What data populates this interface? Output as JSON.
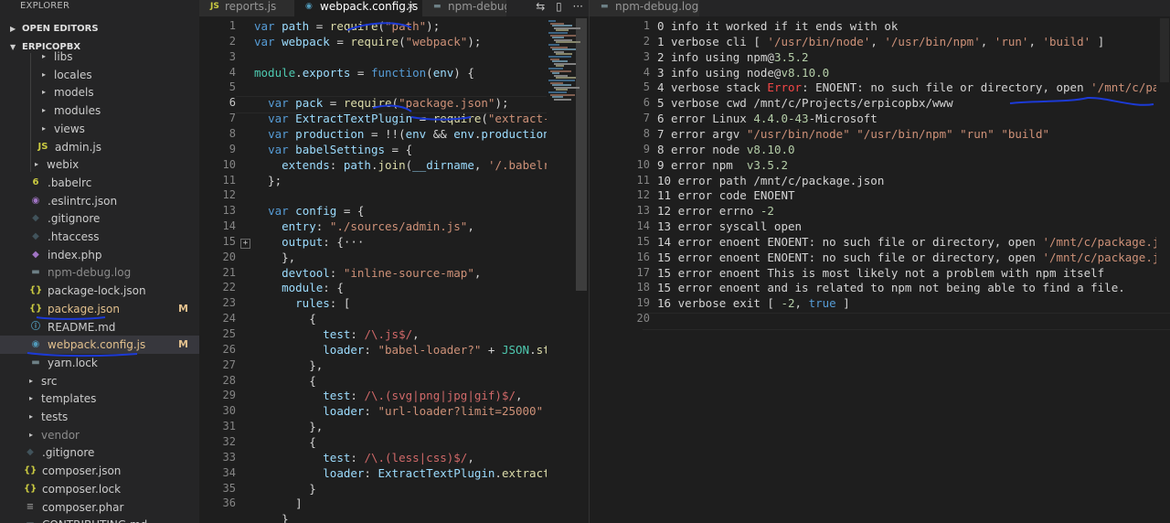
{
  "explorer": {
    "title": "EXPLORER",
    "open_editors": "OPEN EDITORS",
    "project": "ERPICOPBX",
    "items": [
      {
        "label": "libs",
        "chev": "▸"
      },
      {
        "label": "locales",
        "chev": "▸"
      },
      {
        "label": "models",
        "chev": "▸"
      },
      {
        "label": "modules",
        "chev": "▸"
      },
      {
        "label": "views",
        "chev": "▸"
      },
      {
        "label": "admin.js",
        "icon": "JS"
      },
      {
        "label": "webix",
        "chev": "▸"
      },
      {
        "label": ".babelrc",
        "icon": "6"
      },
      {
        "label": ".eslintrc.json",
        "icon": "◉"
      },
      {
        "label": ".gitignore",
        "icon": "◆"
      },
      {
        "label": ".htaccess",
        "icon": "◆"
      },
      {
        "label": "index.php",
        "icon": "◆"
      },
      {
        "label": "npm-debug.log",
        "icon": "▬"
      },
      {
        "label": "package-lock.json",
        "icon": "{}"
      },
      {
        "label": "package.json",
        "icon": "{}",
        "badge": "M"
      },
      {
        "label": "README.md",
        "icon": "ⓘ"
      },
      {
        "label": "webpack.config.js",
        "icon": "◉",
        "badge": "M"
      },
      {
        "label": "yarn.lock",
        "icon": "▬"
      },
      {
        "label": "src",
        "chev": "▸"
      },
      {
        "label": "templates",
        "chev": "▸"
      },
      {
        "label": "tests",
        "chev": "▸"
      },
      {
        "label": "vendor",
        "chev": "▸"
      },
      {
        "label": ".gitignore",
        "icon": "◆"
      },
      {
        "label": "composer.json",
        "icon": "{}"
      },
      {
        "label": "composer.lock",
        "icon": "{}"
      },
      {
        "label": "composer.phar",
        "icon": "≡"
      },
      {
        "label": "CONTRIBUTING.md",
        "icon": "▬"
      }
    ]
  },
  "tabs": {
    "reports": "reports.js",
    "webpack": "webpack.config.js",
    "npm_debug": "npm-debug.",
    "npm_debug_right": "npm-debug.log",
    "close": "×",
    "js_icon": "JS",
    "webpack_icon": "◉",
    "log_icon": "▬"
  },
  "actions": {
    "compare": "⇆",
    "split": "▯",
    "more": "···"
  },
  "fold_marker": "+",
  "editor1": {
    "line_numbers": [
      "1",
      "2",
      "3",
      "4",
      "5",
      "6",
      "7",
      "8",
      "9",
      "10",
      "11",
      "12",
      "13",
      "14",
      "15",
      "20",
      "21",
      "22",
      "23",
      "24",
      "25",
      "26",
      "27",
      "28",
      "29",
      "30",
      "31",
      "32",
      "33",
      "34",
      "35",
      "36"
    ],
    "lines": [
      [
        [
          "k",
          "var "
        ],
        [
          "v",
          "path"
        ],
        [
          "p",
          " = "
        ],
        [
          "f",
          "require"
        ],
        [
          "p",
          "("
        ],
        [
          "s",
          "\"path\""
        ],
        [
          "p",
          ");"
        ]
      ],
      [
        [
          "k",
          "var "
        ],
        [
          "v",
          "webpack"
        ],
        [
          "p",
          " = "
        ],
        [
          "f",
          "require"
        ],
        [
          "p",
          "("
        ],
        [
          "s",
          "\"webpack\""
        ],
        [
          "p",
          ");"
        ]
      ],
      [],
      [
        [
          "c",
          "module"
        ],
        [
          "p",
          "."
        ],
        [
          "v",
          "exports"
        ],
        [
          "p",
          " = "
        ],
        [
          "k",
          "function"
        ],
        [
          "p",
          "("
        ],
        [
          "v",
          "env"
        ],
        [
          "p",
          ") {"
        ]
      ],
      [],
      [
        [
          "p",
          "  "
        ],
        [
          "k",
          "var "
        ],
        [
          "v",
          "pack"
        ],
        [
          "p",
          " = "
        ],
        [
          "f",
          "require"
        ],
        [
          "p",
          "("
        ],
        [
          "s",
          "\"package.json\""
        ],
        [
          "p",
          ");"
        ]
      ],
      [
        [
          "p",
          "  "
        ],
        [
          "k",
          "var "
        ],
        [
          "v",
          "ExtractTextPlugin"
        ],
        [
          "p",
          " = "
        ],
        [
          "f",
          "require"
        ],
        [
          "p",
          "("
        ],
        [
          "s",
          "\"extract-text"
        ]
      ],
      [
        [
          "p",
          "  "
        ],
        [
          "k",
          "var "
        ],
        [
          "v",
          "production"
        ],
        [
          "p",
          " = !!("
        ],
        [
          "v",
          "env"
        ],
        [
          "p",
          " && "
        ],
        [
          "v",
          "env"
        ],
        [
          "p",
          "."
        ],
        [
          "v",
          "production"
        ],
        [
          "p",
          " ==="
        ]
      ],
      [
        [
          "p",
          "  "
        ],
        [
          "k",
          "var "
        ],
        [
          "v",
          "babelSettings"
        ],
        [
          "p",
          " = {"
        ]
      ],
      [
        [
          "p",
          "    "
        ],
        [
          "v",
          "extends"
        ],
        [
          "p",
          ": "
        ],
        [
          "v",
          "path"
        ],
        [
          "p",
          "."
        ],
        [
          "f",
          "join"
        ],
        [
          "p",
          "("
        ],
        [
          "v",
          "__dirname"
        ],
        [
          "p",
          ", "
        ],
        [
          "s",
          "'/.babelrc'"
        ],
        [
          "p",
          ")"
        ]
      ],
      [
        [
          "p",
          "  };"
        ]
      ],
      [],
      [
        [
          "p",
          "  "
        ],
        [
          "k",
          "var "
        ],
        [
          "v",
          "config"
        ],
        [
          "p",
          " = {"
        ]
      ],
      [
        [
          "p",
          "    "
        ],
        [
          "v",
          "entry"
        ],
        [
          "p",
          ": "
        ],
        [
          "s",
          "\"./sources/admin.js\""
        ],
        [
          "p",
          ","
        ]
      ],
      [
        [
          "p",
          "    "
        ],
        [
          "v",
          "output"
        ],
        [
          "p",
          ": {···"
        ]
      ],
      [
        [
          "p",
          "    },"
        ]
      ],
      [
        [
          "p",
          "    "
        ],
        [
          "v",
          "devtool"
        ],
        [
          "p",
          ": "
        ],
        [
          "s",
          "\"inline-source-map\""
        ],
        [
          "p",
          ","
        ]
      ],
      [
        [
          "p",
          "    "
        ],
        [
          "v",
          "module"
        ],
        [
          "p",
          ": {"
        ]
      ],
      [
        [
          "p",
          "      "
        ],
        [
          "v",
          "rules"
        ],
        [
          "p",
          ": ["
        ]
      ],
      [
        [
          "p",
          "        {"
        ]
      ],
      [
        [
          "p",
          "          "
        ],
        [
          "v",
          "test"
        ],
        [
          "p",
          ": "
        ],
        [
          "r",
          "/\\.js$/"
        ],
        [
          "p",
          ","
        ]
      ],
      [
        [
          "p",
          "          "
        ],
        [
          "v",
          "loader"
        ],
        [
          "p",
          ": "
        ],
        [
          "s",
          "\"babel-loader?\""
        ],
        [
          "p",
          " + "
        ],
        [
          "c",
          "JSON"
        ],
        [
          "p",
          "."
        ],
        [
          "f",
          "string"
        ]
      ],
      [
        [
          "p",
          "        },"
        ]
      ],
      [
        [
          "p",
          "        {"
        ]
      ],
      [
        [
          "p",
          "          "
        ],
        [
          "v",
          "test"
        ],
        [
          "p",
          ": "
        ],
        [
          "r",
          "/\\.(svg|png|jpg|gif)$/"
        ],
        [
          "p",
          ","
        ]
      ],
      [
        [
          "p",
          "          "
        ],
        [
          "v",
          "loader"
        ],
        [
          "p",
          ": "
        ],
        [
          "s",
          "\"url-loader?limit=25000\""
        ]
      ],
      [
        [
          "p",
          "        },"
        ]
      ],
      [
        [
          "p",
          "        {"
        ]
      ],
      [
        [
          "p",
          "          "
        ],
        [
          "v",
          "test"
        ],
        [
          "p",
          ": "
        ],
        [
          "r",
          "/\\.(less|css)$/"
        ],
        [
          "p",
          ","
        ]
      ],
      [
        [
          "p",
          "          "
        ],
        [
          "v",
          "loader"
        ],
        [
          "p",
          ": "
        ],
        [
          "v",
          "ExtractTextPlugin"
        ],
        [
          "p",
          "."
        ],
        [
          "f",
          "extract"
        ],
        [
          "p",
          "("
        ],
        [
          "s",
          "\"cs"
        ]
      ],
      [
        [
          "p",
          "        }"
        ]
      ],
      [
        [
          "p",
          "      ]"
        ]
      ],
      [
        [
          "p",
          "    }"
        ]
      ]
    ]
  },
  "editor2": {
    "line_numbers": [
      "1",
      "2",
      "3",
      "4",
      "5",
      "6",
      "7",
      "8",
      "9",
      "10",
      "11",
      "12",
      "13",
      "14",
      "15",
      "16",
      "17",
      "18",
      "19",
      "20"
    ],
    "lines": [
      [
        [
          "p",
          "0 info it worked if it ends with ok"
        ]
      ],
      [
        [
          "p",
          "1 verbose cli [ "
        ],
        [
          "s",
          "'/usr/bin/node'"
        ],
        [
          "p",
          ", "
        ],
        [
          "s",
          "'/usr/bin/npm'"
        ],
        [
          "p",
          ", "
        ],
        [
          "s",
          "'run'"
        ],
        [
          "p",
          ", "
        ],
        [
          "s",
          "'build'"
        ],
        [
          "p",
          " ]"
        ]
      ],
      [
        [
          "p",
          "2 info using npm@"
        ],
        [
          "n",
          "3.5.2"
        ]
      ],
      [
        [
          "p",
          "3 info using node@"
        ],
        [
          "n",
          "v8.10.0"
        ]
      ],
      [
        [
          "p",
          "4 verbose stack "
        ],
        [
          "er",
          "Error"
        ],
        [
          "p",
          ": ENOENT: no such file or directory, open "
        ],
        [
          "s",
          "'/mnt/c/package.jso"
        ]
      ],
      [
        [
          "p",
          "5 verbose cwd /mnt/c/Projects/erpicopbx/www"
        ]
      ],
      [
        [
          "p",
          "6 error Linux "
        ],
        [
          "n",
          "4.4.0-43"
        ],
        [
          "p",
          "-Microsoft"
        ]
      ],
      [
        [
          "p",
          "7 error argv "
        ],
        [
          "s",
          "\"/usr/bin/node\""
        ],
        [
          "p",
          " "
        ],
        [
          "s",
          "\"/usr/bin/npm\""
        ],
        [
          "p",
          " "
        ],
        [
          "s",
          "\"run\""
        ],
        [
          "p",
          " "
        ],
        [
          "s",
          "\"build\""
        ]
      ],
      [
        [
          "p",
          "8 error node "
        ],
        [
          "n",
          "v8.10.0"
        ]
      ],
      [
        [
          "p",
          "9 error npm  "
        ],
        [
          "n",
          "v3.5.2"
        ]
      ],
      [
        [
          "p",
          "10 error path /mnt/c/package.json"
        ]
      ],
      [
        [
          "p",
          "11 error code ENOENT"
        ]
      ],
      [
        [
          "p",
          "12 error errno "
        ],
        [
          "n",
          "-2"
        ]
      ],
      [
        [
          "p",
          "13 error syscall open"
        ]
      ],
      [
        [
          "p",
          "14 error enoent ENOENT: no such file or directory, open "
        ],
        [
          "s",
          "'/mnt/c/package.json'"
        ]
      ],
      [
        [
          "p",
          "15 error enoent ENOENT: no such file or directory, open "
        ],
        [
          "s",
          "'/mnt/c/package.json'"
        ]
      ],
      [
        [
          "p",
          "15 error enoent This is most likely not a problem with npm itself"
        ]
      ],
      [
        [
          "p",
          "15 error enoent and is related to npm not being able to find a file."
        ]
      ],
      [
        [
          "p",
          "16 verbose exit [ "
        ],
        [
          "n",
          "-2"
        ],
        [
          "p",
          ", "
        ],
        [
          "k",
          "true"
        ],
        [
          "p",
          " ]"
        ]
      ],
      []
    ]
  }
}
